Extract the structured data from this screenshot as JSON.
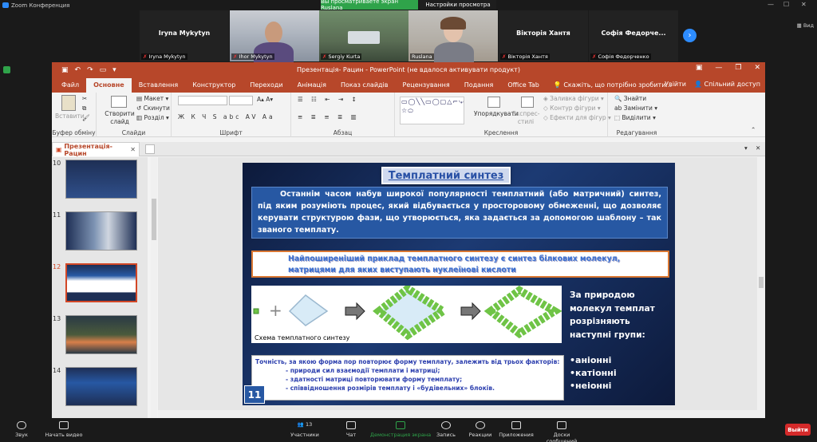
{
  "zoom": {
    "window_title": "Zoom Конференция",
    "share_banner": "Вы просматриваете экран Ruslana",
    "view_options": "Настройки просмотра",
    "view_button": "Вид",
    "participants": [
      {
        "name": "Iryna Mykytyn",
        "label": "Iryna Mykytyn",
        "video": false
      },
      {
        "name": "",
        "label": "Ihor Mykytyn",
        "video": true
      },
      {
        "name": "",
        "label": "Sergiy Kurta",
        "video": true
      },
      {
        "name": "",
        "label": "Ruslana",
        "video": true
      },
      {
        "name": "Вікторія Хантя",
        "label": "Вікторія Хантя",
        "video": false
      },
      {
        "name": "Софія  Федорче...",
        "label": "Софія Федорченко",
        "video": false
      }
    ],
    "toolbar": {
      "audio": "Звук",
      "video": "Начать видео",
      "participants": "Участники",
      "participants_count": "13",
      "chat": "Чат",
      "share": "Демонстрация экрана",
      "record": "Запись",
      "reactions": "Реакции",
      "apps": "Приложения",
      "whiteboards": "Доски сообщений",
      "leave": "Выйти"
    }
  },
  "ppt": {
    "title": "Презентація- Рацин  -  PowerPoint (не вдалося активувати продукт)",
    "tabs": [
      "Файл",
      "Основне",
      "Вставлення",
      "Конструктор",
      "Переходи",
      "Анімація",
      "Показ слайдів",
      "Рецензування",
      "Подання",
      "Office Tab"
    ],
    "active_tab": "Основне",
    "tell_me": "Скажіть, що потрібно зробити...",
    "sign_in": "Увійти",
    "share": "Спільний доступ",
    "ribbon": {
      "clipboard": {
        "label": "Буфер обміну",
        "paste": "Вставити"
      },
      "slides": {
        "label": "Слайди",
        "new_slide": "Створити слайд",
        "layout": "Макет",
        "reset": "Скинути",
        "section": "Розділ"
      },
      "font": {
        "label": "Шрифт"
      },
      "paragraph": {
        "label": "Абзац"
      },
      "drawing": {
        "label": "Креслення",
        "arrange": "Упорядкувати",
        "quick_styles": "Експрес-стилі",
        "fill": "Заливка фігури",
        "outline": "Контур фігури",
        "effects": "Ефекти для фігур"
      },
      "editing": {
        "label": "Редагування",
        "find": "Знайти",
        "replace": "Замінити",
        "select": "Виділити"
      }
    },
    "doc_tab": "Презентація- Рацин",
    "thumbnails": [
      {
        "num": "10",
        "selected": false
      },
      {
        "num": "11",
        "selected": false
      },
      {
        "num": "12",
        "selected": true
      },
      {
        "num": "13",
        "selected": false
      },
      {
        "num": "14",
        "selected": false
      }
    ]
  },
  "slide": {
    "title": "Темплатний синтез",
    "intro": "Останнім часом набув широкої популярності темплатний (або матричний) синтез, під яким розуміють процес, який відбувається у просторовому обмеженні, що дозволяє керувати структурою фази, що утворюється, яка задається за допомогою шаблону – так званого темплату.",
    "example": "Найпоширеніший приклад темплатного синтезу є синтез  білкових молекул, матрицями для яких виступають нуклеїнові кислоти",
    "scheme_caption": "Схема темплатного синтезу",
    "scheme_label": "За природою молекул темплат розрізняють наступні групи:",
    "types": [
      "•аніонні",
      "•катіонні",
      "•неіонні"
    ],
    "factors_lead": "Точність, за якою форма пор повторює форму темплату, залежить від трьох факторів:",
    "factors": [
      "- природи сил взаємодії темплати і матриці;",
      "- здатності матриці повторювати форму темплату;",
      "- співвідношення розмірів темплату і «будівельних» блоків."
    ],
    "number": "11"
  }
}
